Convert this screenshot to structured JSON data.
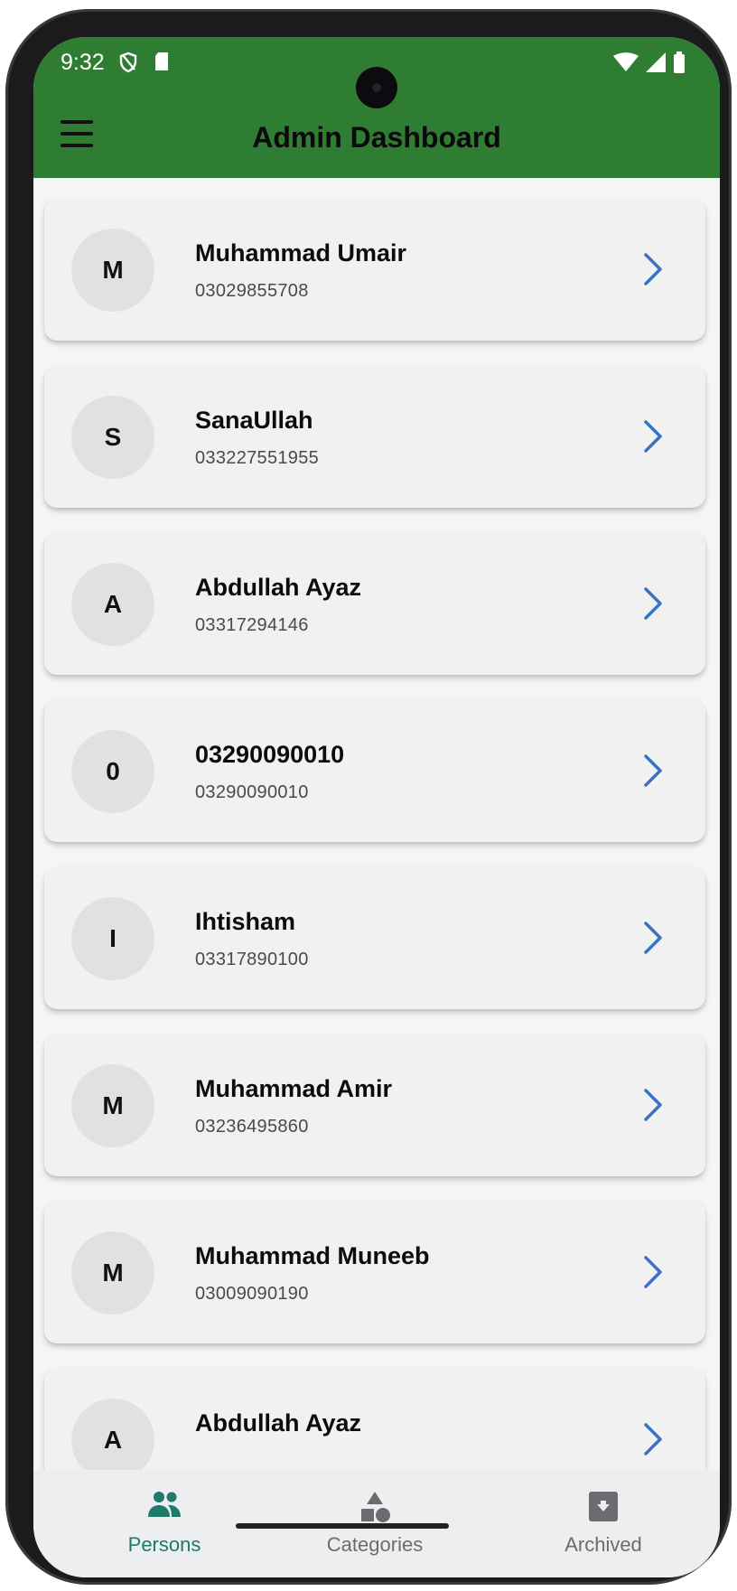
{
  "status_bar": {
    "time": "9:32",
    "left_icons": [
      "shield-icon",
      "sd-card-icon"
    ],
    "right_icons": [
      "wifi-icon",
      "signal-icon",
      "battery-icon"
    ]
  },
  "app_bar": {
    "title": "Admin Dashboard",
    "menu_icon": "hamburger-menu-icon",
    "color": "#2e7d32"
  },
  "persons": [
    {
      "initial": "M",
      "name": "Muhammad Umair",
      "phone": "03029855708"
    },
    {
      "initial": "S",
      "name": "SanaUllah",
      "phone": "033227551955"
    },
    {
      "initial": "A",
      "name": "Abdullah Ayaz",
      "phone": "03317294146"
    },
    {
      "initial": "0",
      "name": "03290090010",
      "phone": "03290090010"
    },
    {
      "initial": "I",
      "name": "Ihtisham",
      "phone": "03317890100"
    },
    {
      "initial": "M",
      "name": "Muhammad Amir",
      "phone": "03236495860"
    },
    {
      "initial": "M",
      "name": "Muhammad Muneeb",
      "phone": "03009090190"
    },
    {
      "initial": "A",
      "name": "Abdullah Ayaz",
      "phone": ""
    }
  ],
  "chevron_color": "#3b73c4",
  "bottom_nav": {
    "items": [
      {
        "label": "Persons",
        "icon": "people-icon",
        "active": true
      },
      {
        "label": "Categories",
        "icon": "shapes-icon",
        "active": false
      },
      {
        "label": "Archived",
        "icon": "archive-icon",
        "active": false
      }
    ],
    "active_color": "#1f7a6a"
  }
}
